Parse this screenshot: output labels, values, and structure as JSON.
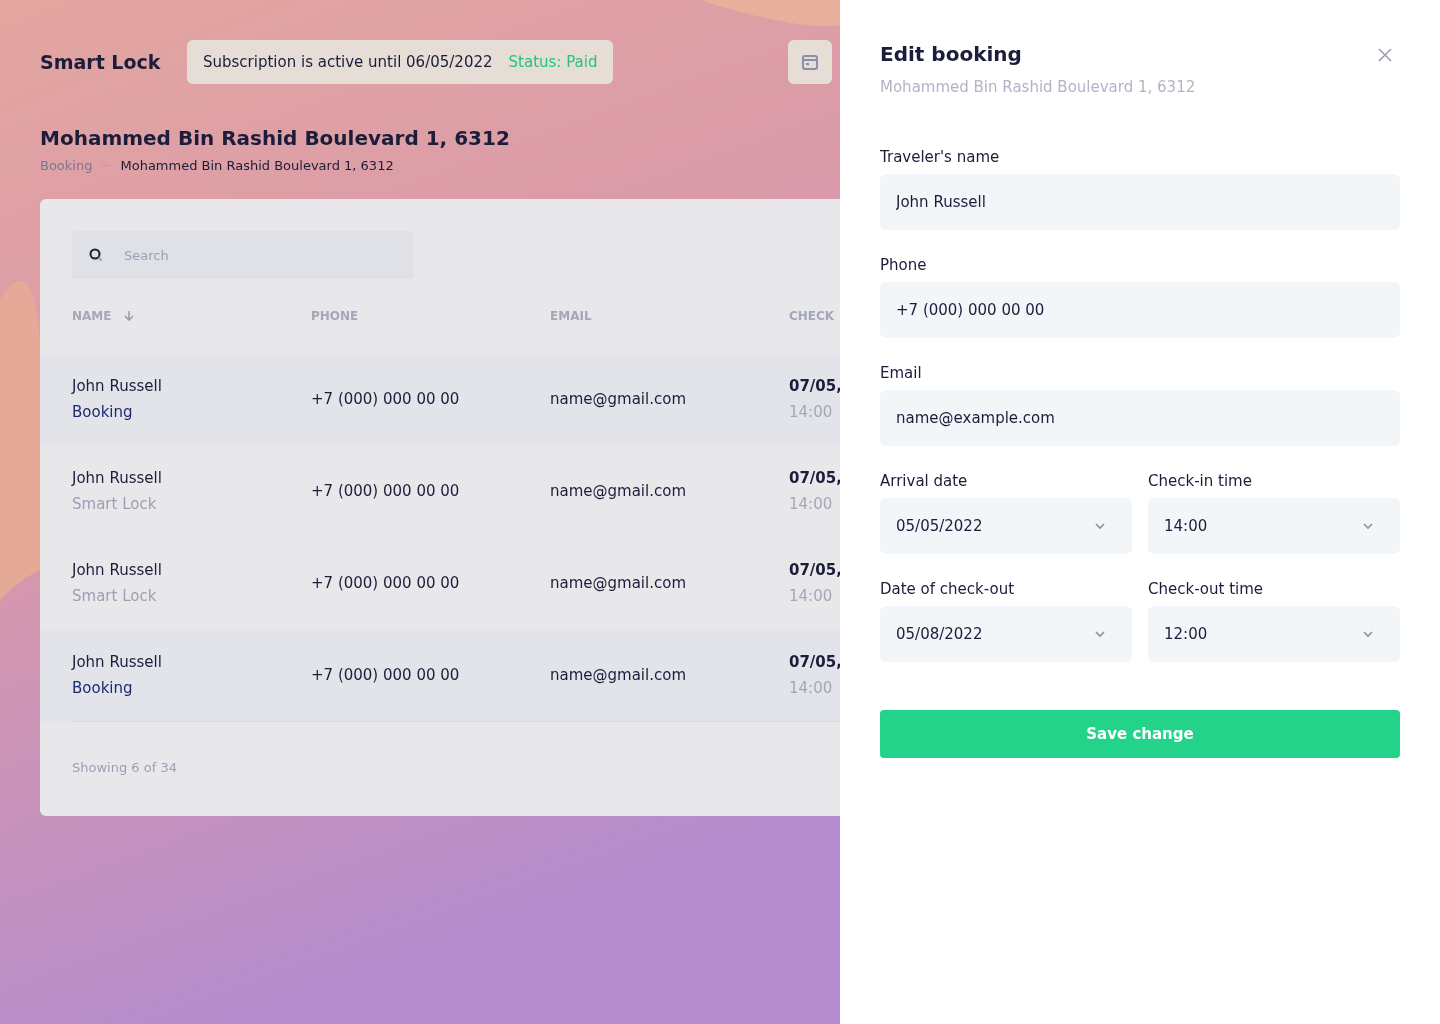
{
  "brand": "Smart Lock",
  "subscription": {
    "text": "Subscription is active until 06/05/2022",
    "status": "Status: Paid"
  },
  "page_title": "Mohammed Bin Rashid Boulevard 1, 6312",
  "breadcrumb": [
    {
      "label": "Booking",
      "current": false
    },
    {
      "label": "Mohammed Bin Rashid Boulevard 1, 6312",
      "current": true
    }
  ],
  "search": {
    "placeholder": "Search"
  },
  "table": {
    "columns": [
      {
        "label": "NAME",
        "sorted": true
      },
      {
        "label": "PHONE",
        "sorted": false
      },
      {
        "label": "EMAIL",
        "sorted": false
      },
      {
        "label": "CHECK",
        "sorted": false
      }
    ],
    "rows": [
      {
        "name": "John Russell",
        "kind": "booking",
        "source": "Booking",
        "phone": "+7 (000) 000 00 00",
        "email": "name@gmail.com",
        "date": "07/05,",
        "time": "14:00"
      },
      {
        "name": "John Russell",
        "kind": "smart-lock",
        "source": "Smart Lock",
        "phone": "+7 (000) 000 00 00",
        "email": "name@gmail.com",
        "date": "07/05,",
        "time": "14:00"
      },
      {
        "name": "John Russell",
        "kind": "smart-lock",
        "source": "Smart Lock",
        "phone": "+7 (000) 000 00 00",
        "email": "name@gmail.com",
        "date": "07/05,",
        "time": "14:00"
      },
      {
        "name": "John Russell",
        "kind": "booking",
        "source": "Booking",
        "phone": "+7 (000) 000 00 00",
        "email": "name@gmail.com",
        "date": "07/05,",
        "time": "14:00"
      }
    ],
    "footer": "Showing 6 of 34"
  },
  "panel": {
    "title": "Edit booking",
    "subtitle": "Mohammed Bin Rashid Boulevard 1, 6312",
    "fields": [
      {
        "label": "Traveler's name",
        "value": "John Russell",
        "kind": "text"
      },
      {
        "label": "Phone",
        "value": "+7 (000) 000 00 00",
        "kind": "text"
      },
      {
        "label": "Email",
        "value": "name@example.com",
        "kind": "text"
      },
      {
        "label": "Arrival date",
        "value": "05/05/2022",
        "kind": "select"
      },
      {
        "label": "Check-in time",
        "value": "14:00",
        "kind": "select"
      },
      {
        "label": "Date of check-out",
        "value": "05/08/2022",
        "kind": "select"
      },
      {
        "label": "Check-out time",
        "value": "12:00",
        "kind": "select"
      }
    ],
    "save": "Save change"
  }
}
